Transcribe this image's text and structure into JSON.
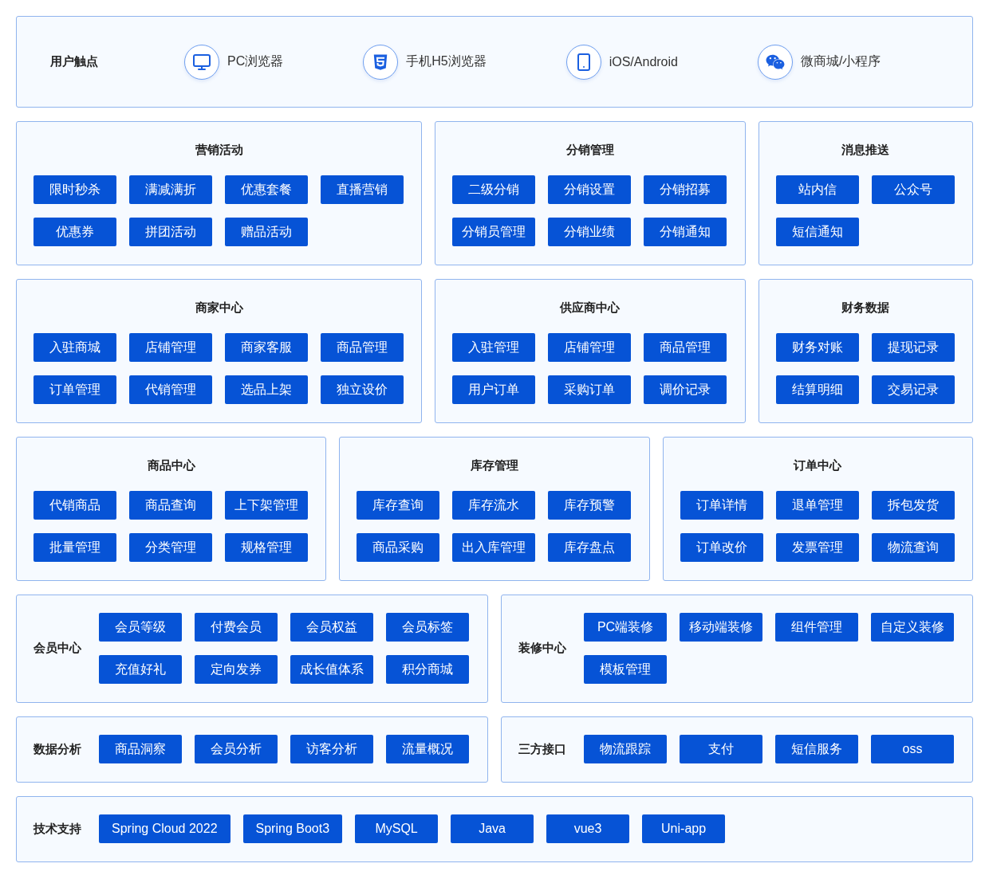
{
  "touchpoints": {
    "label": "用户触点",
    "items": [
      {
        "kind": "desktop",
        "label": "PC浏览器"
      },
      {
        "kind": "html5",
        "label": "手机H5浏览器"
      },
      {
        "kind": "phone",
        "label": "iOS/Android"
      },
      {
        "kind": "chat",
        "label": "微商城/小程序"
      }
    ]
  },
  "rows": [
    {
      "panels": [
        {
          "kind": "stacked",
          "title": "营销活动",
          "buttons": [
            "限时秒杀",
            "满减满折",
            "优惠套餐",
            "直播营销",
            "优惠券",
            "拼团活动",
            "赠品活动"
          ]
        },
        {
          "kind": "stacked",
          "title": "分销管理",
          "buttons": [
            "二级分销",
            "分销设置",
            "分销招募",
            "分销员管理",
            "分销业绩",
            "分销通知"
          ]
        },
        {
          "kind": "stacked",
          "title": "消息推送",
          "buttons": [
            "站内信",
            "公众号",
            "短信通知"
          ]
        }
      ]
    },
    {
      "panels": [
        {
          "kind": "stacked",
          "title": "商家中心",
          "buttons": [
            "入驻商城",
            "店铺管理",
            "商家客服",
            "商品管理",
            "订单管理",
            "代销管理",
            "选品上架",
            "独立设价"
          ]
        },
        {
          "kind": "stacked",
          "title": "供应商中心",
          "buttons": [
            "入驻管理",
            "店铺管理",
            "商品管理",
            "用户订单",
            "采购订单",
            "调价记录"
          ]
        },
        {
          "kind": "stacked",
          "title": "财务数据",
          "buttons": [
            "财务对账",
            "提现记录",
            "结算明细",
            "交易记录"
          ]
        }
      ]
    },
    {
      "panels": [
        {
          "kind": "stacked",
          "title": "商品中心",
          "buttons": [
            "代销商品",
            "商品查询",
            "上下架管理",
            "批量管理",
            "分类管理",
            "规格管理"
          ]
        },
        {
          "kind": "stacked",
          "title": "库存管理",
          "buttons": [
            "库存查询",
            "库存流水",
            "库存预警",
            "商品采购",
            "出入库管理",
            "库存盘点"
          ]
        },
        {
          "kind": "stacked",
          "title": "订单中心",
          "buttons": [
            "订单详情",
            "退单管理",
            "拆包发货",
            "订单改价",
            "发票管理",
            "物流查询"
          ]
        }
      ]
    },
    {
      "panels": [
        {
          "kind": "inline",
          "title": "会员中心",
          "buttons": [
            "会员等级",
            "付费会员",
            "会员权益",
            "会员标签",
            "充值好礼",
            "定向发券",
            "成长值体系",
            "积分商城"
          ]
        },
        {
          "kind": "inline",
          "title": "装修中心",
          "buttons": [
            "PC端装修",
            "移动端装修",
            "组件管理",
            "自定义装修",
            "模板管理"
          ]
        }
      ]
    },
    {
      "panels": [
        {
          "kind": "inline",
          "title": "数据分析",
          "buttons": [
            "商品洞察",
            "会员分析",
            "访客分析",
            "流量概况"
          ]
        },
        {
          "kind": "inline",
          "title": "三方接口",
          "buttons": [
            "物流跟踪",
            "支付",
            "短信服务",
            "oss"
          ]
        }
      ]
    },
    {
      "panels": [
        {
          "kind": "wide",
          "title": "技术支持",
          "buttons": [
            "Spring Cloud 2022",
            "Spring Boot3",
            "MySQL",
            "Java",
            "vue3",
            "Uni-app"
          ]
        }
      ]
    }
  ]
}
